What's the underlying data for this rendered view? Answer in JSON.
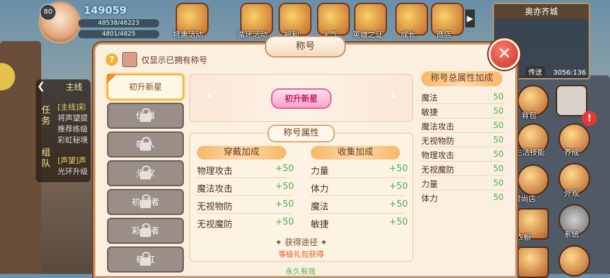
{
  "player": {
    "level": "80",
    "power": "149059",
    "hp": "48538/46223",
    "mp": "4801/4825"
  },
  "top_menu": [
    {
      "label": "特惠活动",
      "icon": "gift-icon"
    },
    {
      "label": "循环活动",
      "icon": "cycle-event-icon"
    },
    {
      "label": "福利",
      "icon": "welfare-icon"
    },
    {
      "label": "人气",
      "icon": "popularity-icon"
    },
    {
      "label": "英雄之证",
      "icon": "hero-proof-icon"
    },
    {
      "label": "成长",
      "icon": "growth-icon"
    },
    {
      "label": "商店",
      "icon": "shop-icon"
    }
  ],
  "mission": {
    "tabs": [
      "任务",
      "组队"
    ],
    "header": "主线",
    "lines": [
      "[主线]彩",
      "将声望提",
      "推荐练级",
      "彩虹秘境",
      "[声望]声",
      "光环升级"
    ]
  },
  "minimap": {
    "location": "奥亦齐城",
    "transfer": "传送",
    "coords": "3056:136"
  },
  "right_menu": [
    "背包",
    "养成",
    "生活技能",
    "外观",
    "时尚店",
    "系统",
    "衣橱"
  ],
  "modal": {
    "title": "称号",
    "close": "✕",
    "filter_label": "仅显示已拥有称号",
    "titles": [
      {
        "name": "初升新星",
        "locked": false
      },
      {
        "name": "伏  雄",
        "locked": true
      },
      {
        "name": "萌  人",
        "locked": true
      },
      {
        "name": "头  家",
        "locked": true
      },
      {
        "name": "初  证者",
        "locked": true
      },
      {
        "name": "彩  护者",
        "locked": true
      },
      {
        "name": "初  虹",
        "locked": true
      }
    ],
    "preview_badge": "初升新星",
    "attr_title": "称号属性",
    "wear_header": "穿戴加成",
    "collect_header": "收集加成",
    "wear": [
      {
        "name": "物理攻击",
        "value": "+50"
      },
      {
        "name": "魔法攻击",
        "value": "+50"
      },
      {
        "name": "无视物防",
        "value": "+50"
      },
      {
        "name": "无视魔防",
        "value": "+50"
      }
    ],
    "collect": [
      {
        "name": "力量",
        "value": "+50"
      },
      {
        "name": "体力",
        "value": "+50"
      },
      {
        "name": "魔法",
        "value": "+50"
      },
      {
        "name": "敏捷",
        "value": "+50"
      }
    ],
    "source_header": "获得途径",
    "source_value": "等级礼包获得",
    "duration": "永久有效",
    "totals_header": "称号总属性加成",
    "totals": [
      {
        "name": "魔法",
        "value": "50"
      },
      {
        "name": "敏捷",
        "value": "50"
      },
      {
        "name": "魔法攻击",
        "value": "50"
      },
      {
        "name": "无视物防",
        "value": "50"
      },
      {
        "name": "物理攻击",
        "value": "50"
      },
      {
        "name": "无视魔防",
        "value": "50"
      },
      {
        "name": "力量",
        "value": "50"
      },
      {
        "name": "体力",
        "value": "50"
      }
    ]
  }
}
